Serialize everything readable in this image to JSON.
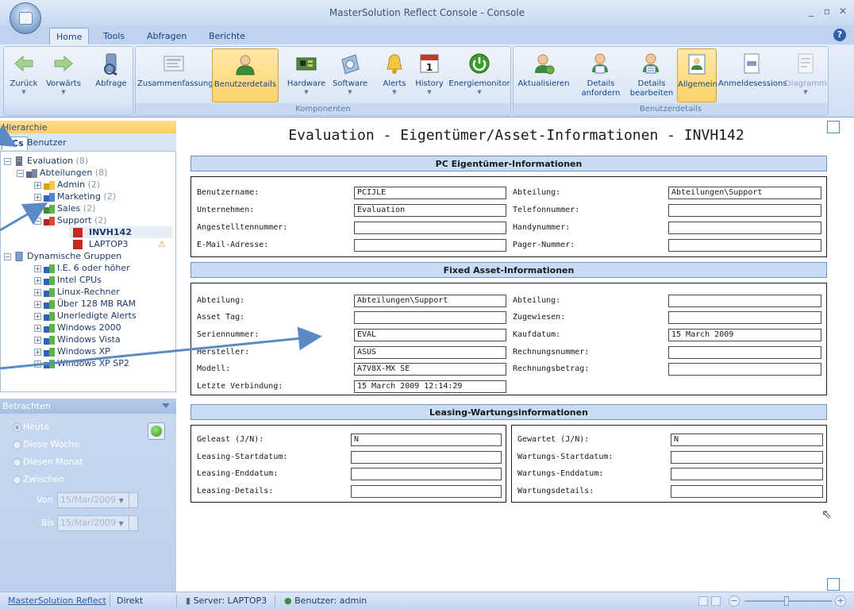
{
  "window": {
    "title": "MasterSolution Reflect Console - Console"
  },
  "tabs": [
    "Home",
    "Tools",
    "Abfragen",
    "Berichte"
  ],
  "ribbon": {
    "nav": [
      {
        "label": "Zurück"
      },
      {
        "label": "Vorwärts"
      },
      {
        "label": "Abfrage"
      }
    ],
    "komponenten": {
      "title": "Komponenten",
      "buttons": [
        {
          "label": "Zusammenfassung"
        },
        {
          "label": "Benutzerdetails"
        },
        {
          "label": "Hardware"
        },
        {
          "label": "Software"
        },
        {
          "label": "Alerts"
        },
        {
          "label": "History"
        },
        {
          "label": "Energiemonitor"
        }
      ]
    },
    "benutzerdetails": {
      "title": "Benutzerdetails",
      "buttons": [
        {
          "label": "Aktualisieren"
        },
        {
          "label": "Details",
          "label2": "anfordern"
        },
        {
          "label": "Details",
          "label2": "bearbeiten"
        },
        {
          "label": "Allgemein"
        },
        {
          "label": "Anmeldesessions"
        },
        {
          "label": "Diagramm"
        }
      ]
    }
  },
  "left": {
    "header": "Hierarchie",
    "subtabs": [
      "PCs",
      "Benutzer"
    ],
    "tree": [
      {
        "label": "Evaluation",
        "count": "(8)"
      },
      {
        "label": "Abteilungen",
        "count": "(8)"
      },
      {
        "label": "Admin",
        "count": "(2)"
      },
      {
        "label": "Marketing",
        "count": "(2)"
      },
      {
        "label": "Sales",
        "count": "(2)"
      },
      {
        "label": "Support",
        "count": "(2)"
      },
      {
        "label": "INVH142",
        "count": ""
      },
      {
        "label": "LAPTOP3",
        "count": ""
      },
      {
        "label": "Dynamische Gruppen",
        "count": ""
      },
      {
        "label": "I.E. 6 oder höher",
        "count": ""
      },
      {
        "label": "Intel CPUs",
        "count": ""
      },
      {
        "label": "Linux-Rechner",
        "count": ""
      },
      {
        "label": "Über 128 MB RAM",
        "count": ""
      },
      {
        "label": "Unerledigte Alerts",
        "count": ""
      },
      {
        "label": "Windows 2000",
        "count": ""
      },
      {
        "label": "Windows Vista",
        "count": ""
      },
      {
        "label": "Windows XP",
        "count": ""
      },
      {
        "label": "Windows XP SP2",
        "count": ""
      }
    ],
    "view": {
      "header": "Betrachten",
      "options": [
        "Heute",
        "Diese Woche",
        "Diesen Monat",
        "Zwischen"
      ],
      "von_label": "Von",
      "bis_label": "Bis",
      "von": "15/Mar/2009",
      "bis": "15/Mar/2009"
    }
  },
  "main": {
    "title": "Evaluation - Eigentümer/Asset-Informationen - INVH142",
    "sections": {
      "owner": {
        "title": "PC Eigentümer-Informationen",
        "left": [
          {
            "label": "Benutzername:",
            "value": "PCIJLE"
          },
          {
            "label": "Unternehmen:",
            "value": "Evaluation"
          },
          {
            "label": "Angestelltennummer:",
            "value": ""
          },
          {
            "label": "E-Mail-Adresse:",
            "value": ""
          }
        ],
        "right": [
          {
            "label": "Abteilung:",
            "value": "Abteilungen\\Support"
          },
          {
            "label": "Telefonnummer:",
            "value": ""
          },
          {
            "label": "Handynummer:",
            "value": ""
          },
          {
            "label": "Pager-Nummer:",
            "value": ""
          }
        ]
      },
      "asset": {
        "title": "Fixed Asset-Informationen",
        "left": [
          {
            "label": "Abteilung:",
            "value": "Abteilungen\\Support"
          },
          {
            "label": "Asset Tag:",
            "value": ""
          },
          {
            "label": "Seriennummer:",
            "value": "EVAL"
          },
          {
            "label": "Hersteller:",
            "value": "ASUS"
          },
          {
            "label": "Modell:",
            "value": "A7V8X-MX SE"
          },
          {
            "label": "Letzte Verbindung:",
            "value": "15 March 2009 12:14:29"
          }
        ],
        "right": [
          {
            "label": "Abteilung:",
            "value": ""
          },
          {
            "label": "Zugewiesen:",
            "value": ""
          },
          {
            "label": "Kaufdatum:",
            "value": "15 March 2009"
          },
          {
            "label": "Rechnungsnummer:",
            "value": ""
          },
          {
            "label": "Rechnungsbetrag:",
            "value": ""
          }
        ]
      },
      "leasing": {
        "title": "Leasing-Wartungsinformationen",
        "left": [
          {
            "label": "Geleast (J/N):",
            "value": "N"
          },
          {
            "label": "Leasing-Startdatum:",
            "value": ""
          },
          {
            "label": "Leasing-Enddatum:",
            "value": ""
          },
          {
            "label": "Leasing-Details:",
            "value": ""
          }
        ],
        "right": [
          {
            "label": "Gewartet (J/N):",
            "value": "N"
          },
          {
            "label": "Wartungs-Startdatum:",
            "value": ""
          },
          {
            "label": "Wartungs-Enddatum:",
            "value": ""
          },
          {
            "label": "Wartungsdetails:",
            "value": ""
          }
        ]
      }
    }
  },
  "status": {
    "app": "MasterSolution Reflect",
    "mode": "Direkt",
    "server": "Server: LAPTOP3",
    "user": "Benutzer: admin"
  }
}
